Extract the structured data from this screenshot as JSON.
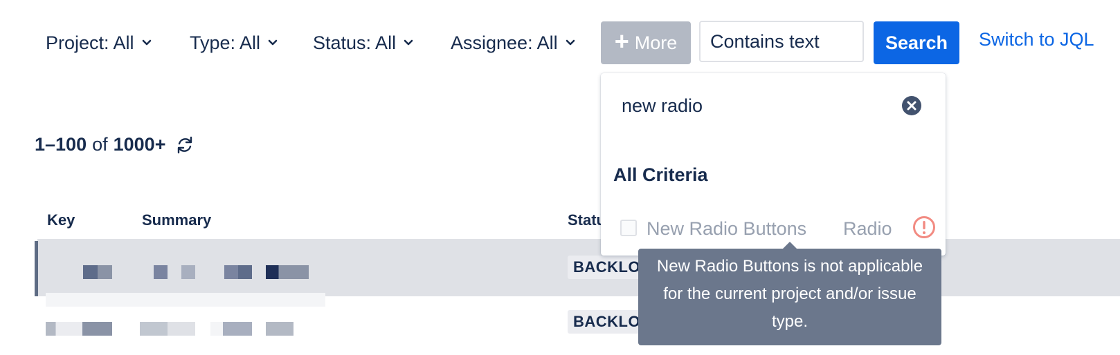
{
  "filters": {
    "project": "Project: All",
    "type": "Type: All",
    "status": "Status: All",
    "assignee": "Assignee: All",
    "more_plus": "+",
    "more_label": "More",
    "text_placeholder": "Contains text",
    "search_label": "Search",
    "switch_jql": "Switch to JQL"
  },
  "results": {
    "range": "1–100",
    "of": "of",
    "total": "1000+"
  },
  "table": {
    "headers": {
      "key": "Key",
      "summary": "Summary",
      "status": "Status"
    },
    "rows": [
      {
        "status": "BACKLOG"
      },
      {
        "status": "BACKLOG"
      }
    ]
  },
  "dropdown": {
    "search_value": "new radio",
    "heading": "All Criteria",
    "criteria": [
      {
        "label": "New Radio Buttons",
        "type": "Radio",
        "applicable": false
      }
    ]
  },
  "tooltip": {
    "text": "New Radio Buttons is not applicable for the current project and/or issue type."
  },
  "colors": {
    "primary": "#0c66e4",
    "text": "#172b4d",
    "more_button": "#b3b9c4",
    "tooltip_bg": "#6b778c",
    "warning": "#f28b82",
    "row_selected": "#dfe1e6"
  }
}
